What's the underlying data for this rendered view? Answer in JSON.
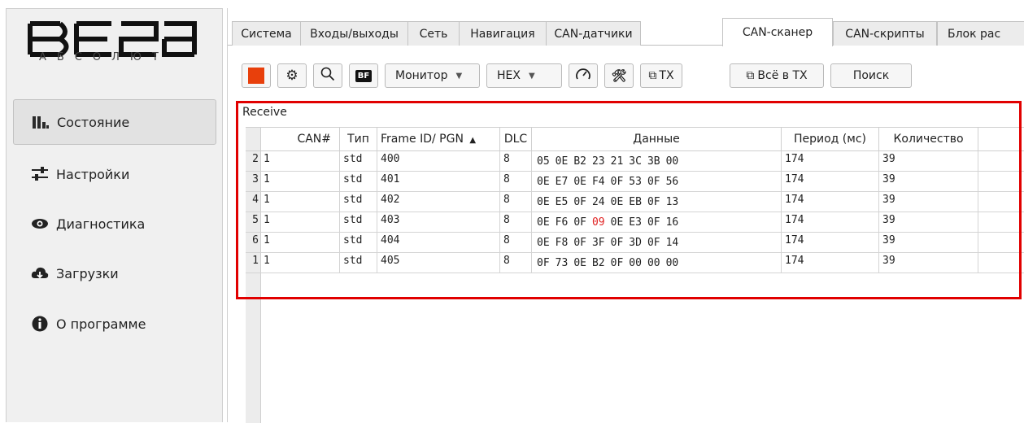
{
  "brand": {
    "logo_text": "ВЕГА",
    "logo_sub": "АБСОЛЮТ"
  },
  "sidebar": {
    "items": [
      {
        "label": "Состояние",
        "icon": "bar-chart-icon",
        "active": true
      },
      {
        "label": "Настройки",
        "icon": "sliders-icon",
        "active": false
      },
      {
        "label": "Диагностика",
        "icon": "eye-icon",
        "active": false
      },
      {
        "label": "Загрузки",
        "icon": "cloud-download-icon",
        "active": false
      },
      {
        "label": "О программе",
        "icon": "info-icon",
        "active": false
      }
    ]
  },
  "tabs": [
    {
      "label": "Система"
    },
    {
      "label": "Входы/выходы"
    },
    {
      "label": "Сеть"
    },
    {
      "label": "Навигация"
    },
    {
      "label": "CAN-датчики"
    },
    {
      "label": "CAN-сканер",
      "active": true
    },
    {
      "label": "CAN-скрипты"
    },
    {
      "label": "Блок рас"
    }
  ],
  "toolbar": {
    "stop_color": "#e8400c",
    "bf_label": "BF",
    "mode_select": "Монитор",
    "format_select": "HEX",
    "tx_label": "TX",
    "all_tx_label": "Всё в TX",
    "search_label": "Поиск"
  },
  "receive": {
    "label": "Receive",
    "columns": [
      "CAN#",
      "Тип",
      "Frame ID/ PGN",
      "DLC",
      "Данные",
      "Период (мс)",
      "Количество"
    ],
    "sort_indicator": "▲",
    "rows": [
      {
        "num": "2",
        "can": "1",
        "type": "std",
        "frame_id": "400",
        "dlc": "8",
        "data": [
          "05",
          "0E",
          "B2",
          "23",
          "21",
          "3C",
          "3B",
          "00"
        ],
        "period": "174",
        "count": "39"
      },
      {
        "num": "3",
        "can": "1",
        "type": "std",
        "frame_id": "401",
        "dlc": "8",
        "data": [
          "0E",
          "E7",
          "0E",
          "F4",
          "0F",
          "53",
          "0F",
          "56"
        ],
        "period": "174",
        "count": "39"
      },
      {
        "num": "4",
        "can": "1",
        "type": "std",
        "frame_id": "402",
        "dlc": "8",
        "data": [
          "0E",
          "E5",
          "0F",
          "24",
          "0E",
          "EB",
          "0F",
          "13"
        ],
        "period": "174",
        "count": "39"
      },
      {
        "num": "5",
        "can": "1",
        "type": "std",
        "frame_id": "403",
        "dlc": "8",
        "data": [
          "0E",
          "F6",
          "0F",
          "09",
          "0E",
          "E3",
          "0F",
          "16"
        ],
        "highlight_index": 3,
        "period": "174",
        "count": "39"
      },
      {
        "num": "6",
        "can": "1",
        "type": "std",
        "frame_id": "404",
        "dlc": "8",
        "data": [
          "0E",
          "F8",
          "0F",
          "3F",
          "0F",
          "3D",
          "0F",
          "14"
        ],
        "period": "174",
        "count": "39"
      },
      {
        "num": "1",
        "can": "1",
        "type": "std",
        "frame_id": "405",
        "dlc": "8",
        "data": [
          "0F",
          "73",
          "0E",
          "B2",
          "0F",
          "00",
          "00",
          "00"
        ],
        "period": "174",
        "count": "39"
      }
    ]
  },
  "colors": {
    "highlight_frame": "#e10000",
    "changed_byte": "#e02020",
    "accent_stop": "#e8400c"
  }
}
